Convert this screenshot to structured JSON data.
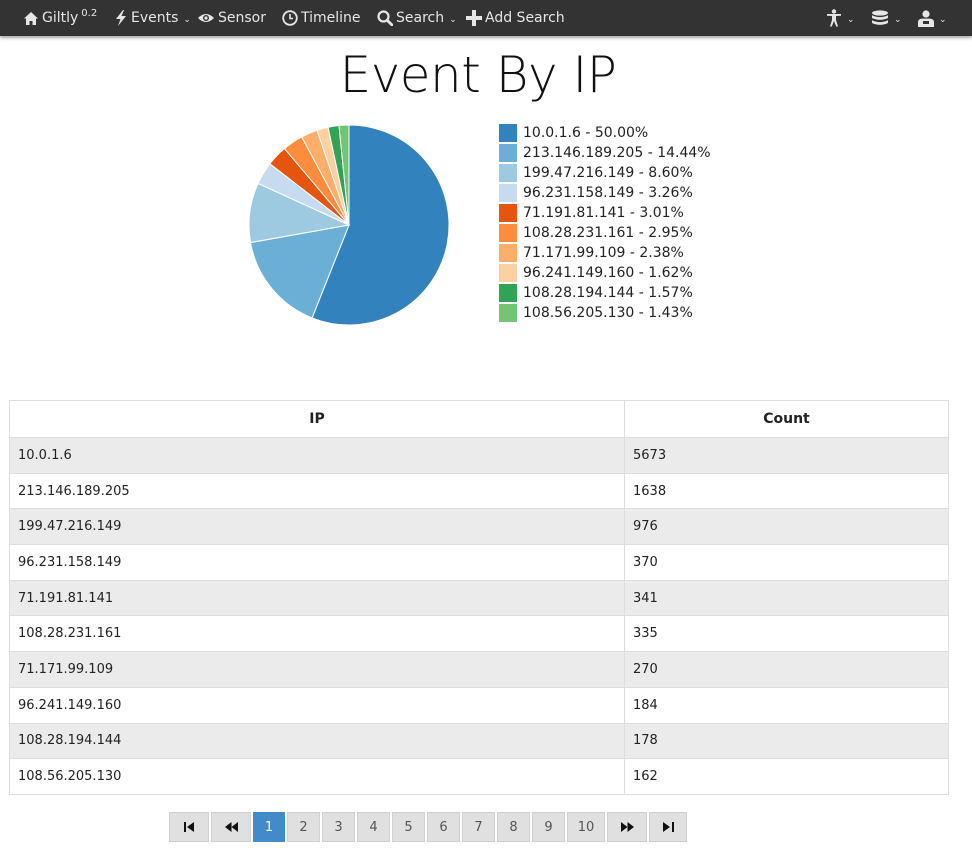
{
  "nav": {
    "brand": "Giltly",
    "brand_version": "0.2",
    "events_label": "Events",
    "sensor_label": "Sensor",
    "timeline_label": "Timeline",
    "search_label": "Search",
    "add_search_label": "Add Search",
    "right_icons": [
      "person-icon",
      "database-icon",
      "user-icon"
    ]
  },
  "page": {
    "title": "Event By IP"
  },
  "chart_data": {
    "type": "pie",
    "title": "Event By IP",
    "slices": [
      {
        "label": "10.0.1.6",
        "value": 5673,
        "percent": "50.00%",
        "color": "#3182bd"
      },
      {
        "label": "213.146.189.205",
        "value": 1638,
        "percent": "14.44%",
        "color": "#6baed6"
      },
      {
        "label": "199.47.216.149",
        "value": 976,
        "percent": "8.60%",
        "color": "#9ecae1"
      },
      {
        "label": "96.231.158.149",
        "value": 370,
        "percent": "3.26%",
        "color": "#c6dbef"
      },
      {
        "label": "71.191.81.141",
        "value": 341,
        "percent": "3.01%",
        "color": "#e6550d"
      },
      {
        "label": "108.28.231.161",
        "value": 335,
        "percent": "2.95%",
        "color": "#fd8d3c"
      },
      {
        "label": "71.171.99.109",
        "value": 270,
        "percent": "2.38%",
        "color": "#fdae6b"
      },
      {
        "label": "96.241.149.160",
        "value": 184,
        "percent": "1.62%",
        "color": "#fdd0a2"
      },
      {
        "label": "108.28.194.144",
        "value": 178,
        "percent": "1.57%",
        "color": "#31a354"
      },
      {
        "label": "108.56.205.130",
        "value": 162,
        "percent": "1.43%",
        "color": "#74c476"
      }
    ],
    "legend_position": "right"
  },
  "table": {
    "headers": [
      "IP",
      "Count"
    ],
    "rows": [
      [
        "10.0.1.6",
        "5673"
      ],
      [
        "213.146.189.205",
        "1638"
      ],
      [
        "199.47.216.149",
        "976"
      ],
      [
        "96.231.158.149",
        "370"
      ],
      [
        "71.191.81.141",
        "341"
      ],
      [
        "108.28.231.161",
        "335"
      ],
      [
        "71.171.99.109",
        "270"
      ],
      [
        "96.241.149.160",
        "184"
      ],
      [
        "108.28.194.144",
        "178"
      ],
      [
        "108.56.205.130",
        "162"
      ]
    ]
  },
  "pagination": {
    "pages": [
      "1",
      "2",
      "3",
      "4",
      "5",
      "6",
      "7",
      "8",
      "9",
      "10"
    ],
    "current": "1",
    "icons": [
      "first-page-icon",
      "previous-page-icon",
      "next-page-icon",
      "last-page-icon"
    ]
  }
}
